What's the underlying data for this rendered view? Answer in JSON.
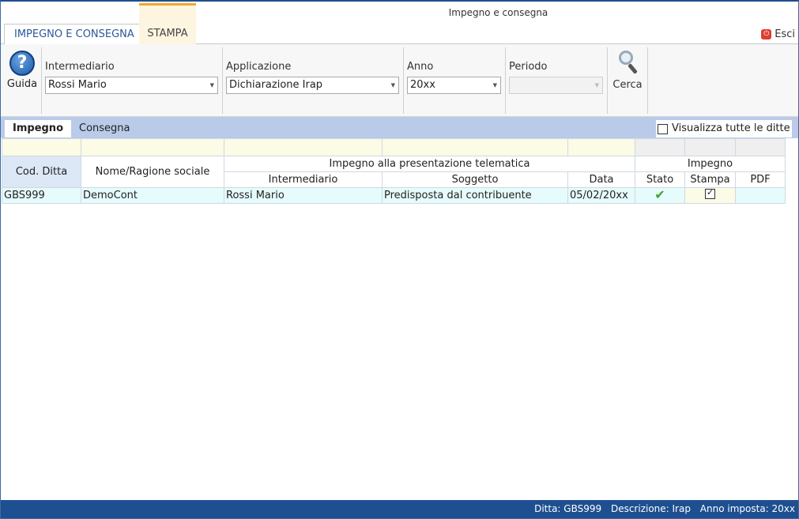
{
  "window": {
    "title": "Impegno e consegna"
  },
  "ribbon": {
    "tabs": [
      {
        "label": "IMPEGNO E CONSEGNA"
      },
      {
        "label": "STAMPA"
      }
    ],
    "exit_label": "Esci",
    "guida_label": "Guida",
    "cerca_label": "Cerca"
  },
  "filters": {
    "intermediario": {
      "label": "Intermediario",
      "value": "Rossi Mario"
    },
    "applicazione": {
      "label": "Applicazione",
      "value": "Dichiarazione Irap"
    },
    "anno": {
      "label": "Anno",
      "value": "20xx"
    },
    "periodo": {
      "label": "Periodo",
      "value": ""
    }
  },
  "subtabs": [
    {
      "label": "Impegno"
    },
    {
      "label": "Consegna"
    }
  ],
  "show_all_label": "Visualizza tutte le ditte",
  "table": {
    "group_impegno_telematico": "Impegno alla presentazione telematica",
    "group_impegno": "Impegno",
    "headers": {
      "cod": "Cod. Ditta",
      "nome": "Nome/Ragione sociale",
      "intermediario": "Intermediario",
      "soggetto": "Soggetto",
      "data": "Data",
      "stato": "Stato",
      "stampa": "Stampa",
      "pdf": "PDF"
    },
    "rows": [
      {
        "cod": "GBS999",
        "nome": "DemoCont",
        "intermediario": "Rossi Mario",
        "soggetto": "Predisposta dal contribuente",
        "data": "05/02/20xx"
      }
    ]
  },
  "statusbar": {
    "ditta": "Ditta: GBS999",
    "descrizione": "Descrizione: Irap",
    "anno": "Anno imposta: 20xx"
  },
  "colors": {
    "accent": "#2b579a",
    "statusbar": "#1e4f91",
    "subtab_bar": "#b9cbe8"
  }
}
